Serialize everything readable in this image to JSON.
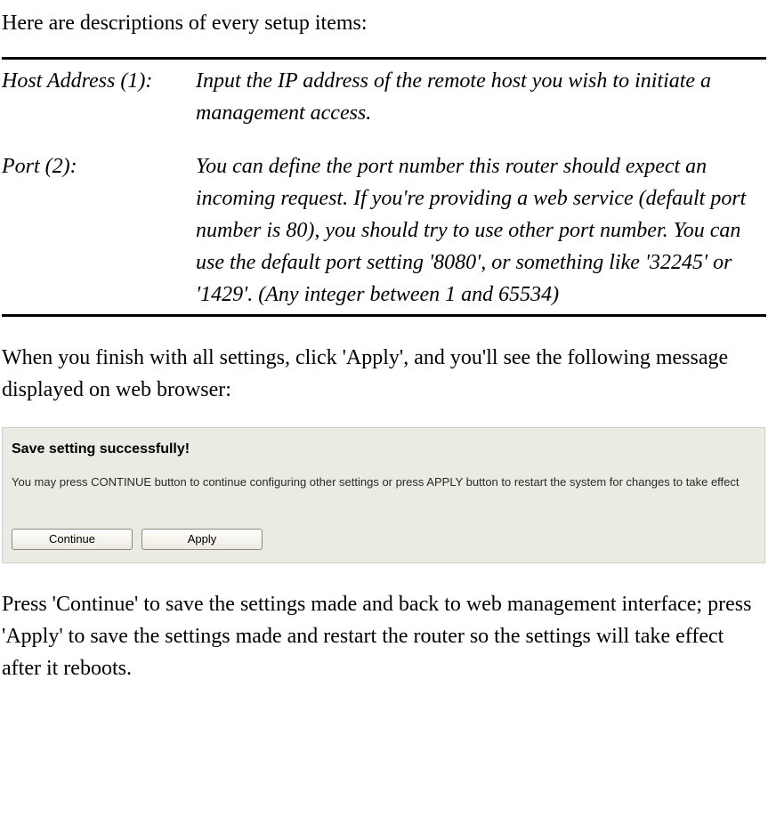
{
  "intro": "Here are descriptions of every setup items:",
  "definitions": {
    "row1": {
      "term": "Host Address (1):",
      "desc": "Input the IP address of the remote host you wish to initiate a management access."
    },
    "row2": {
      "term": "Port (2):",
      "desc": "You can define the port number this router should expect an incoming request. If you're providing a web service (default port number is 80), you should try to use other port number. You can use the default port setting '8080', or something like '32245' or '1429'. (Any integer between 1 and 65534)"
    }
  },
  "afterTable": "When you finish with all settings, click 'Apply', and you'll see the following message displayed on web browser:",
  "dialog": {
    "title": "Save setting successfully!",
    "text": "You may press CONTINUE button to continue configuring other settings or press APPLY button to restart the system for changes to take effect",
    "continueLabel": "Continue",
    "applyLabel": "Apply"
  },
  "closing": "Press 'Continue' to save the settings made and back to web management interface; press 'Apply' to save the settings made and restart the router so the settings will take effect after it reboots."
}
